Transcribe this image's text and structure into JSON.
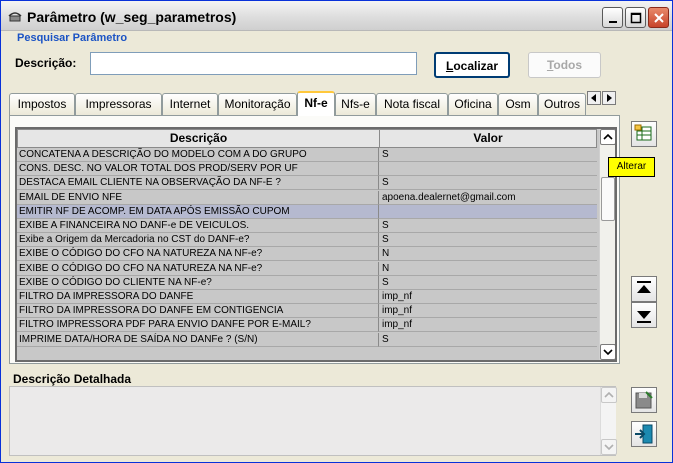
{
  "window": {
    "title": "Parâmetro (w_seg_parametros)"
  },
  "search": {
    "group_title": "Pesquisar Parâmetro",
    "description_label": "Descrição:",
    "description_value": "",
    "find_button": "Localizar",
    "all_button": "Todos"
  },
  "tabs": [
    {
      "label": "Impostos"
    },
    {
      "label": "Impressoras"
    },
    {
      "label": "Internet"
    },
    {
      "label": "Monitoração"
    },
    {
      "label": "Nf-e",
      "active": true
    },
    {
      "label": "Nfs-e"
    },
    {
      "label": "Nota fiscal"
    },
    {
      "label": "Oficina"
    },
    {
      "label": "Osm"
    },
    {
      "label": "Outros"
    }
  ],
  "grid": {
    "columns": [
      "Descrição",
      "Valor"
    ],
    "rows": [
      {
        "descricao": "CONCATENA A DESCRIÇÃO DO MODELO COM A DO GRUPO",
        "valor": "S"
      },
      {
        "descricao": "CONS. DESC. NO VALOR TOTAL DOS PROD/SERV POR UF",
        "valor": ""
      },
      {
        "descricao": "DESTACA EMAIL CLIENTE NA OBSERVAÇÃO DA NF-E ?",
        "valor": "S"
      },
      {
        "descricao": "EMAIL DE ENVIO NFE",
        "valor": "apoena.dealernet@gmail.com"
      },
      {
        "descricao": "EMITIR NF DE ACOMP. EM DATA APÓS EMISSÃO CUPOM",
        "valor": "",
        "selected": true
      },
      {
        "descricao": "EXIBE A FINANCEIRA NO DANF-e DE VEICULOS.",
        "valor": "S"
      },
      {
        "descricao": "Exibe a Origem da Mercadoria no CST do DANF-e?",
        "valor": "S"
      },
      {
        "descricao": "EXIBE O CÓDIGO DO CFO NA NATUREZA NA NF-e?",
        "valor": "N"
      },
      {
        "descricao": "EXIBE O CÓDIGO DO CFO NA NATUREZA NA NF-e?",
        "valor": "N"
      },
      {
        "descricao": "EXIBE O CÓDIGO DO CLIENTE NA NF-e?",
        "valor": "S"
      },
      {
        "descricao": "FILTRO DA IMPRESSORA DO DANFE",
        "valor": "imp_nf"
      },
      {
        "descricao": "FILTRO DA IMPRESSORA DO DANFE EM CONTIGENCIA",
        "valor": "imp_nf"
      },
      {
        "descricao": "FILTRO IMPRESSORA PDF PARA ENVIO DANFE POR E-MAIL?",
        "valor": "imp_nf"
      },
      {
        "descricao": "IMPRIME DATA/HORA DE SAÍDA NO DANFe ? (S/N)",
        "valor": "S"
      }
    ]
  },
  "tooltip": "Alterar",
  "detail": {
    "label": "Descrição Detalhada",
    "value": ""
  },
  "colors": {
    "selected_row": "#b5b9cf",
    "search_title": "#1b53c4",
    "tooltip_bg": "#ffff00"
  }
}
